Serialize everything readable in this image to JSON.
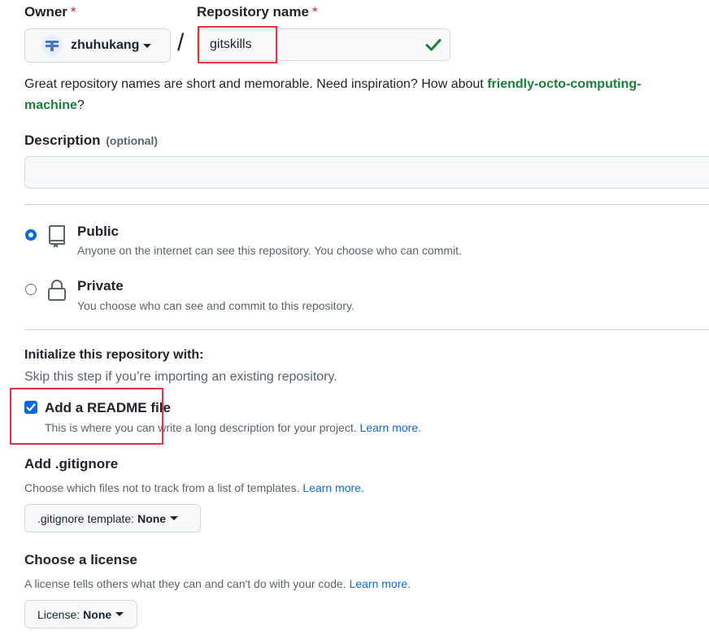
{
  "owner": {
    "label": "Owner",
    "required_mark": "*",
    "value": "zhuhukang"
  },
  "repo_name": {
    "label": "Repository name",
    "required_mark": "*",
    "separator": "/",
    "value": "gitskills"
  },
  "name_hint": {
    "text": "Great repository names are short and memorable. Need inspiration? How about ",
    "suggestion_line1": "friendly-octo-computing-",
    "suggestion_line2": "machine",
    "suffix": "?"
  },
  "description": {
    "label": "Description",
    "optional": "(optional)",
    "value": ""
  },
  "visibility": {
    "public": {
      "title": "Public",
      "desc": "Anyone on the internet can see this repository. You choose who can commit.",
      "selected": true
    },
    "private": {
      "title": "Private",
      "desc": "You choose who can see and commit to this repository.",
      "selected": false
    }
  },
  "init": {
    "heading": "Initialize this repository with:",
    "subtext": "Skip this step if you’re importing an existing repository.",
    "readme_label": "Add a README file",
    "readme_desc": "This is where you can write a long description for your project.",
    "readme_link": "Learn more.",
    "readme_checked": true
  },
  "gitignore": {
    "heading": "Add .gitignore",
    "desc": "Choose which files not to track from a list of templates.",
    "link": "Learn more.",
    "button_prefix": ".gitignore template:",
    "button_value": "None"
  },
  "license": {
    "heading": "Choose a license",
    "desc": "A license tells others what they can and can't do with your code.",
    "link": "Learn more.",
    "button_prefix": "License:",
    "button_value": "None"
  },
  "colors": {
    "accent": "#0969da",
    "success": "#1a7f37",
    "danger": "#cf222e",
    "annotation": "#e5323c"
  }
}
